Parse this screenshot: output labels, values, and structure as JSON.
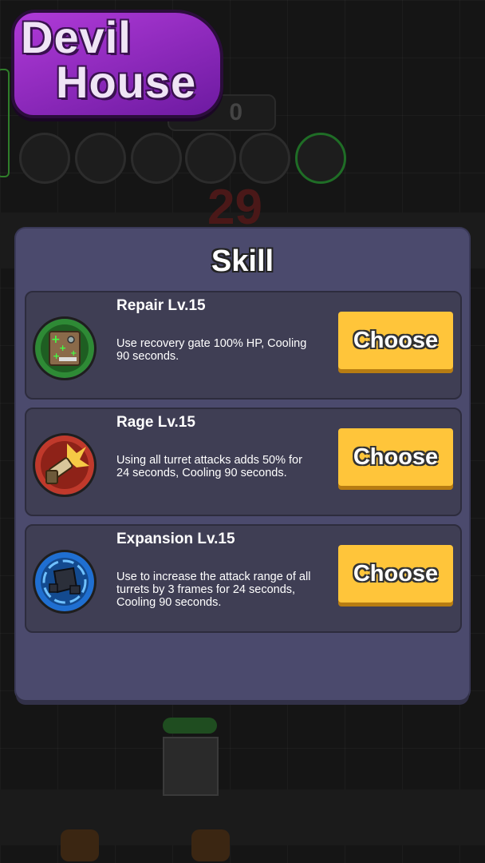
{
  "game": {
    "logo_line1": "Devil",
    "logo_line2": "House",
    "counter_value": "0",
    "timer_value": "29"
  },
  "dialog": {
    "title": "Skill",
    "skills": [
      {
        "name": "Repair Lv.15",
        "description": "Use recovery gate 100% HP, Cooling 90 seconds.",
        "button_label": "Choose",
        "icon": "repair-icon"
      },
      {
        "name": "Rage Lv.15",
        "description": "Using all turret attacks adds 50% for 24 seconds, Cooling 90 seconds.",
        "button_label": "Choose",
        "icon": "rage-icon"
      },
      {
        "name": "Expansion Lv.15",
        "description": "Use to increase the attack range of all turrets by 3 frames for 24 seconds, Cooling 90 seconds.",
        "button_label": "Choose",
        "icon": "expansion-icon"
      }
    ]
  },
  "colors": {
    "dialog_bg": "#4b4a6d",
    "card_bg": "#3f3e54",
    "button": "#ffc53a",
    "logo": "#b03ad8"
  }
}
